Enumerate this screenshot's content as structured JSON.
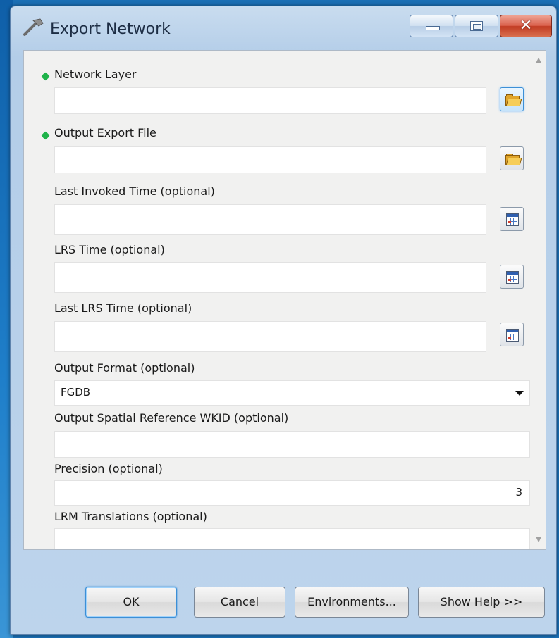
{
  "window": {
    "title": "Export Network",
    "close_glyph": "✕"
  },
  "fields": {
    "network_layer": {
      "label": "Network Layer",
      "value": ""
    },
    "output_export_file": {
      "label": "Output Export File",
      "value": ""
    },
    "last_invoked_time": {
      "label": "Last Invoked Time (optional)",
      "value": ""
    },
    "lrs_time": {
      "label": "LRS Time (optional)",
      "value": ""
    },
    "last_lrs_time": {
      "label": "Last LRS Time (optional)",
      "value": ""
    },
    "output_format": {
      "label": "Output Format (optional)",
      "value": "FGDB"
    },
    "spatial_reference": {
      "label": "Output Spatial Reference WKID (optional)",
      "value": ""
    },
    "precision": {
      "label": "Precision (optional)",
      "value": "3"
    },
    "lrm_translations": {
      "label": "LRM Translations (optional)",
      "value": ""
    }
  },
  "buttons": {
    "ok": "OK",
    "cancel": "Cancel",
    "environments": "Environments...",
    "show_help": "Show Help >>"
  },
  "icons": {
    "title": "hammer-tool-icon",
    "browse": "folder-open-icon",
    "calendar": "calendar-icon",
    "required": "required-dot-icon"
  },
  "colors": {
    "desktop": "#1b6fb5",
    "window_frame": "#bdd4ec",
    "client_bg": "#f1f1f0",
    "required_dot": "#1fb34a",
    "close_button": "#c13b22",
    "focus_blue": "#3c8fd6"
  }
}
